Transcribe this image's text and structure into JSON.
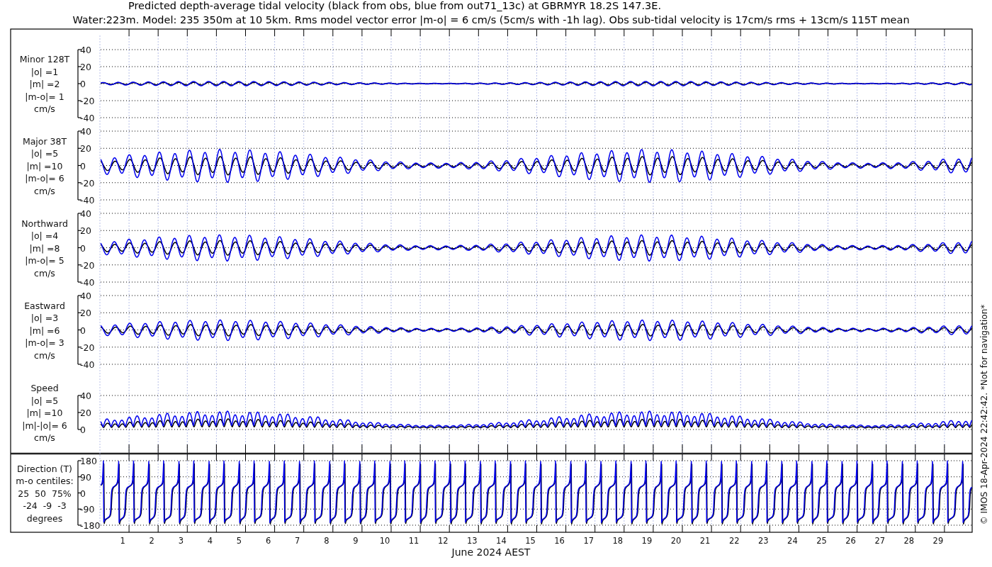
{
  "title_lines": [
    "Predicted depth-average tidal velocity (black from obs, blue from out71_13c) at GBRMYR 18.2S 147.3E.",
    "Water:223m. Model: 235 350m at 10 5km. Rms model vector error |m-o| = 6 cm/s (5cm/s with -1h lag). Obs sub-tidal velocity is 17cm/s rms + 13cm/s 115T mean"
  ],
  "panels": [
    {
      "kind": "minor",
      "label": [
        "Minor 128T",
        "|o| =1",
        "|m| =2",
        "|m-o|= 1",
        "cm/s"
      ],
      "y_ticks": [
        "40",
        "20",
        "0",
        "-20",
        "-40"
      ]
    },
    {
      "kind": "major",
      "label": [
        "Major 38T",
        "|o| =5",
        "|m| =10",
        "|m-o|= 6",
        "cm/s"
      ],
      "y_ticks": [
        "40",
        "20",
        "0",
        "-20",
        "-40"
      ]
    },
    {
      "kind": "northward",
      "label": [
        "Northward",
        "|o| =4",
        "|m| =8",
        "|m-o|= 5",
        "cm/s"
      ],
      "y_ticks": [
        "40",
        "20",
        "0",
        "-20",
        "-40"
      ]
    },
    {
      "kind": "eastward",
      "label": [
        "Eastward",
        "|o| =3",
        "|m| =6",
        "|m-o|= 3",
        "cm/s"
      ],
      "y_ticks": [
        "40",
        "20",
        "0",
        "-20",
        "-40"
      ]
    },
    {
      "kind": "speed",
      "label": [
        "Speed",
        "|o| =5",
        "|m| =10",
        "|m|-|o|= 6",
        "cm/s"
      ],
      "y_ticks": [
        "40",
        "20",
        "0"
      ]
    },
    {
      "kind": "direction",
      "label": [
        "Direction (T)",
        "m-o centiles:",
        "25  50  75%",
        "-24  -9  -3",
        "degrees"
      ],
      "y_ticks": [
        "180",
        "90",
        "0",
        "-90",
        "-180"
      ]
    }
  ],
  "x_axis": {
    "day_labels": [
      "1",
      "2",
      "3",
      "4",
      "5",
      "6",
      "7",
      "8",
      "9",
      "10",
      "11",
      "12",
      "13",
      "14",
      "15",
      "16",
      "17",
      "18",
      "19",
      "20",
      "21",
      "22",
      "23",
      "24",
      "25",
      "26",
      "27",
      "28",
      "29"
    ],
    "title": "June 2024 AEST"
  },
  "side_note": "© IMOS 18-Apr-2024 22:42:42. *Not for navigation*"
}
